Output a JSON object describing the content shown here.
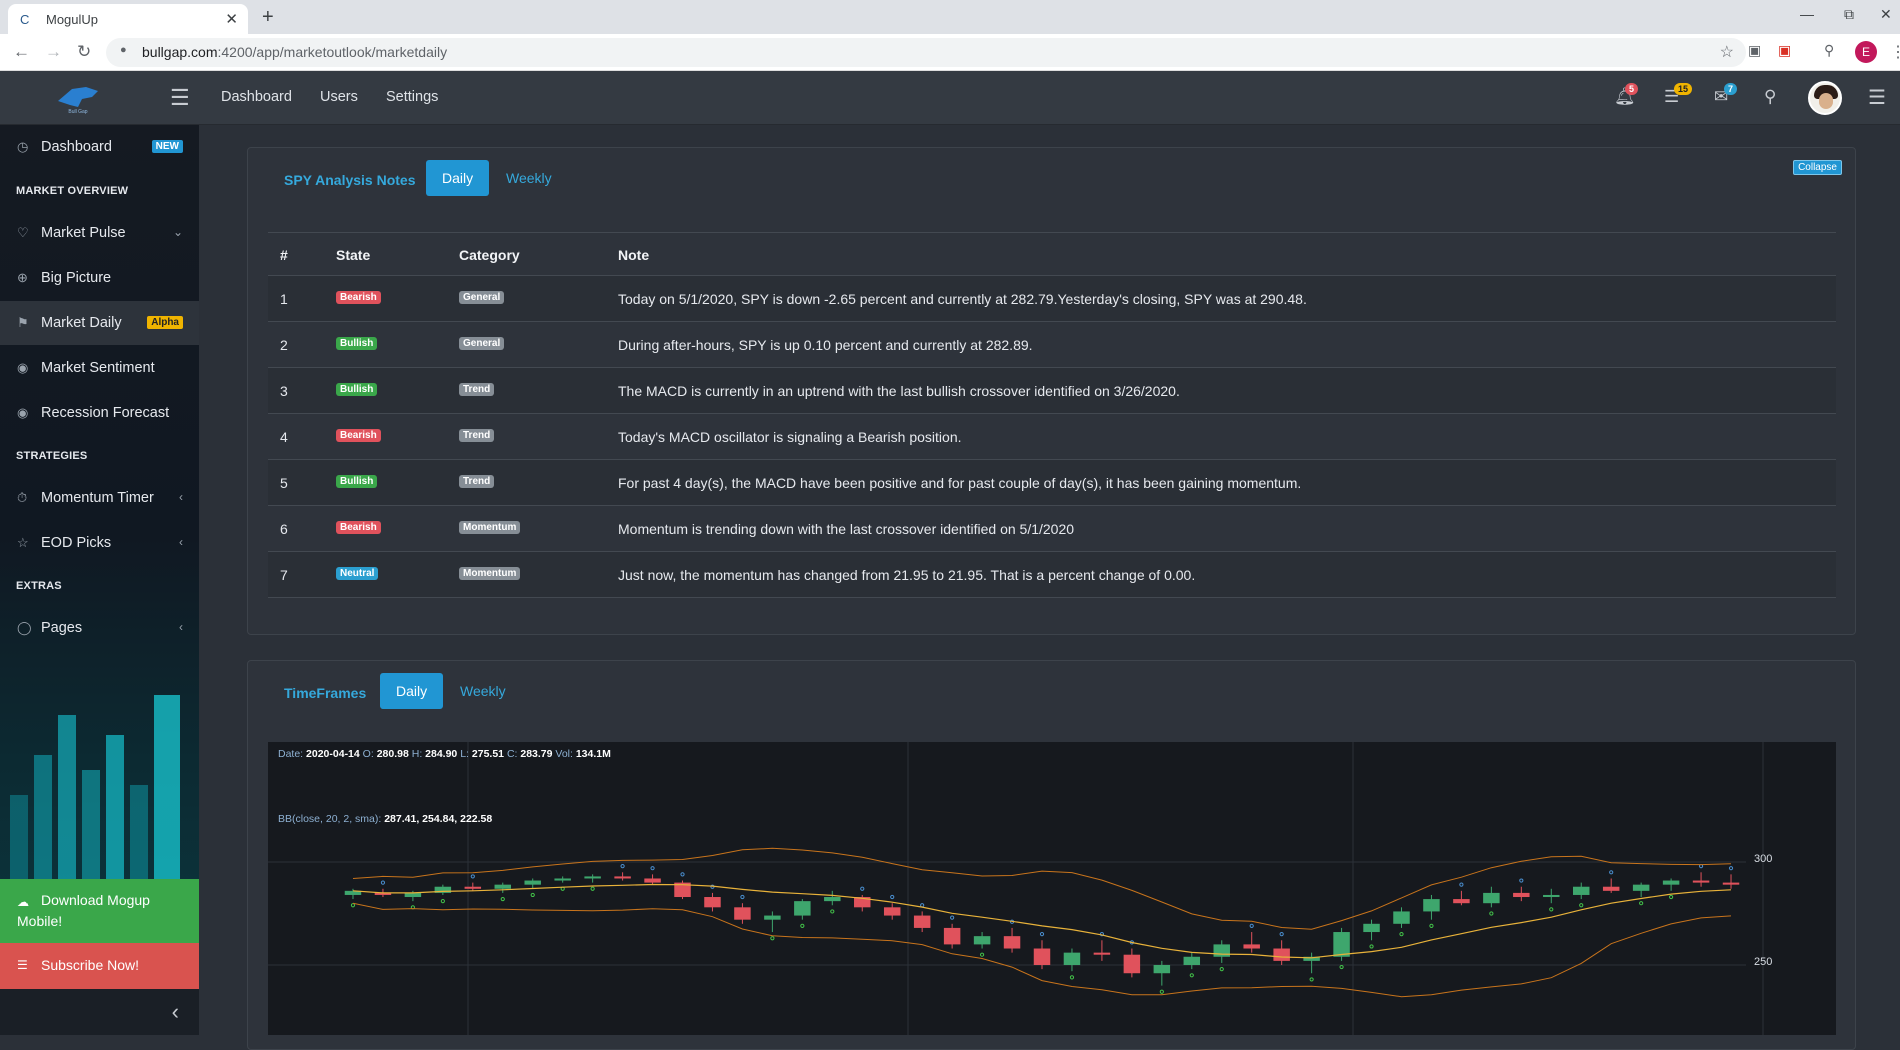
{
  "browser": {
    "tab_title": "MogulUp",
    "url_host": "bullgap.com",
    "url_path": ":4200/app/marketoutlook/marketdaily",
    "profile_letter": "E"
  },
  "topnav": {
    "links": [
      "Dashboard",
      "Users",
      "Settings"
    ],
    "notifications_count": "5",
    "tasks_count": "15",
    "messages_count": "7"
  },
  "sidebar": {
    "dashboard": "Dashboard",
    "dashboard_badge": "NEW",
    "market_overview_heading": "MARKET OVERVIEW",
    "market_pulse": "Market Pulse",
    "big_picture": "Big Picture",
    "market_daily": "Market Daily",
    "market_daily_badge": "Alpha",
    "market_sentiment": "Market Sentiment",
    "recession_forecast": "Recession Forecast",
    "strategies_heading": "STRATEGIES",
    "momentum_timer": "Momentum Timer",
    "eod_picks": "EOD Picks",
    "extras_heading": "EXTRAS",
    "pages": "Pages",
    "download_cta": "Download Mogup Mobile!",
    "subscribe_cta": "Subscribe Now!"
  },
  "analysis": {
    "title": "SPY Analysis Notes",
    "tab_daily": "Daily",
    "tab_weekly": "Weekly",
    "collapse": "Collapse",
    "columns": [
      "#",
      "State",
      "Category",
      "Note"
    ],
    "rows": [
      {
        "n": "1",
        "state": "Bearish",
        "category": "General",
        "note": "Today on 5/1/2020, SPY is down -2.65 percent and currently at 282.79.Yesterday's closing, SPY was at 290.48."
      },
      {
        "n": "2",
        "state": "Bullish",
        "category": "General",
        "note": "During after-hours, SPY is up 0.10 percent and currently at 282.89."
      },
      {
        "n": "3",
        "state": "Bullish",
        "category": "Trend",
        "note": "The MACD is currently in an uptrend with the last bullish crossover identified on 3/26/2020."
      },
      {
        "n": "4",
        "state": "Bearish",
        "category": "Trend",
        "note": "Today's MACD oscillator is signaling a Bearish position."
      },
      {
        "n": "5",
        "state": "Bullish",
        "category": "Trend",
        "note": "For past 4 day(s), the MACD have been positive and for past couple of day(s), it has been gaining momentum."
      },
      {
        "n": "6",
        "state": "Bearish",
        "category": "Momentum",
        "note": "Momentum is trending down with the last crossover identified on 5/1/2020"
      },
      {
        "n": "7",
        "state": "Neutral",
        "category": "Momentum",
        "note": "Just now, the momentum has changed from 21.95 to 21.95. That is a percent change of 0.00."
      }
    ],
    "state_colors": {
      "Bearish": "#e0525c",
      "Bullish": "#3aa74a",
      "Neutral": "#2b9fd0"
    },
    "category_color": "#868e96"
  },
  "timeframes": {
    "title": "TimeFrames",
    "tab_daily": "Daily",
    "tab_weekly": "Weekly"
  },
  "chart": {
    "date_label": "Date:",
    "date": "2020-04-14",
    "o_label": "O:",
    "open": "280.98",
    "h_label": "H:",
    "high": "284.90",
    "l_label": "L:",
    "low": "275.51",
    "c_label": "C:",
    "close": "283.79",
    "vol_label": "Vol:",
    "volume": "134.1M",
    "bb_label": "BB(close, 20, 2, sma):",
    "bb_values": "287.41, 254.84, 222.58",
    "y_ticks": [
      "300",
      "250"
    ]
  },
  "chart_data": {
    "type": "candlestick",
    "ylim": [
      230,
      320
    ],
    "y_ticks": [
      250,
      300
    ],
    "candles": [
      [
        284,
        287,
        282,
        286
      ],
      [
        285,
        287,
        283,
        284
      ],
      [
        283,
        286,
        281,
        285
      ],
      [
        285,
        289,
        284,
        288
      ],
      [
        288,
        290,
        286,
        287
      ],
      [
        287,
        290,
        285,
        289
      ],
      [
        289,
        292,
        287,
        291
      ],
      [
        291,
        293,
        290,
        292
      ],
      [
        292,
        294,
        290,
        293
      ],
      [
        293,
        295,
        291,
        292
      ],
      [
        292,
        294,
        289,
        290
      ],
      [
        290,
        291,
        282,
        283
      ],
      [
        283,
        285,
        276,
        278
      ],
      [
        278,
        280,
        270,
        272
      ],
      [
        272,
        276,
        266,
        274
      ],
      [
        274,
        282,
        272,
        281
      ],
      [
        281,
        286,
        279,
        283
      ],
      [
        283,
        284,
        276,
        278
      ],
      [
        278,
        280,
        272,
        274
      ],
      [
        274,
        276,
        266,
        268
      ],
      [
        268,
        270,
        258,
        260
      ],
      [
        260,
        266,
        258,
        264
      ],
      [
        264,
        268,
        256,
        258
      ],
      [
        258,
        262,
        248,
        250
      ],
      [
        250,
        258,
        247,
        256
      ],
      [
        256,
        262,
        252,
        255
      ],
      [
        255,
        258,
        244,
        246
      ],
      [
        246,
        252,
        240,
        250
      ],
      [
        250,
        256,
        248,
        254
      ],
      [
        254,
        262,
        251,
        260
      ],
      [
        260,
        266,
        256,
        258
      ],
      [
        258,
        262,
        250,
        252
      ],
      [
        252,
        256,
        246,
        254
      ],
      [
        254,
        268,
        252,
        266
      ],
      [
        266,
        272,
        262,
        270
      ],
      [
        270,
        278,
        268,
        276
      ],
      [
        276,
        284,
        272,
        282
      ],
      [
        282,
        286,
        279,
        280
      ],
      [
        280,
        288,
        278,
        285
      ],
      [
        285,
        288,
        281,
        283
      ],
      [
        283,
        287,
        280,
        284
      ],
      [
        284,
        290,
        282,
        288
      ],
      [
        288,
        292,
        285,
        286
      ],
      [
        286,
        290,
        283,
        289
      ],
      [
        289,
        292,
        286,
        291
      ],
      [
        291,
        295,
        288,
        290
      ],
      [
        290,
        294,
        287,
        289
      ]
    ]
  }
}
